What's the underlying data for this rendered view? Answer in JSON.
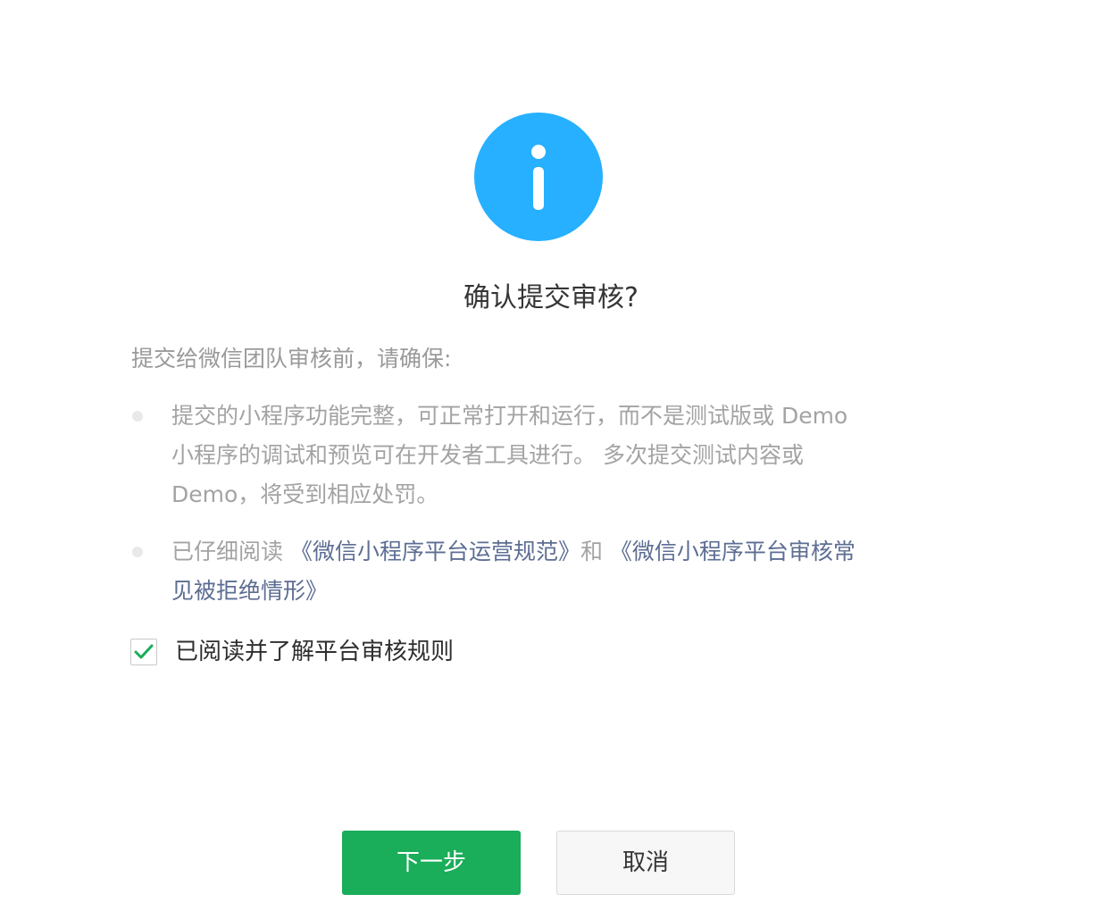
{
  "dialog": {
    "title": "确认提交审核?",
    "intro": "提交给微信团队审核前，请确保:",
    "items": [
      {
        "lines": [
          "提交的小程序功能完整，可正常打开和运行，而不是测试版或 Demo",
          "小程序的调试和预览可在开发者工具进行。 多次提交测试内容或",
          "Demo，将受到相应处罚。"
        ]
      },
      {
        "prefix": "已仔细阅读 ",
        "link1": "《微信小程序平台运营规范》",
        "middle": "和 ",
        "link2_line1": "《微信小程序平台审核常",
        "link2_line2": "见被拒绝情形》"
      }
    ],
    "checkbox": {
      "checked": true,
      "label": "已阅读并了解平台审核规则"
    },
    "buttons": {
      "next_label": "下一步",
      "cancel_label": "取消"
    }
  },
  "icons": {
    "header": "info-icon",
    "check": "checkmark-icon"
  },
  "colors": {
    "info_blue": "#26b0ff",
    "primary_green": "#1aad5a",
    "link": "#5d6e93",
    "check_green": "#1aad5a"
  }
}
